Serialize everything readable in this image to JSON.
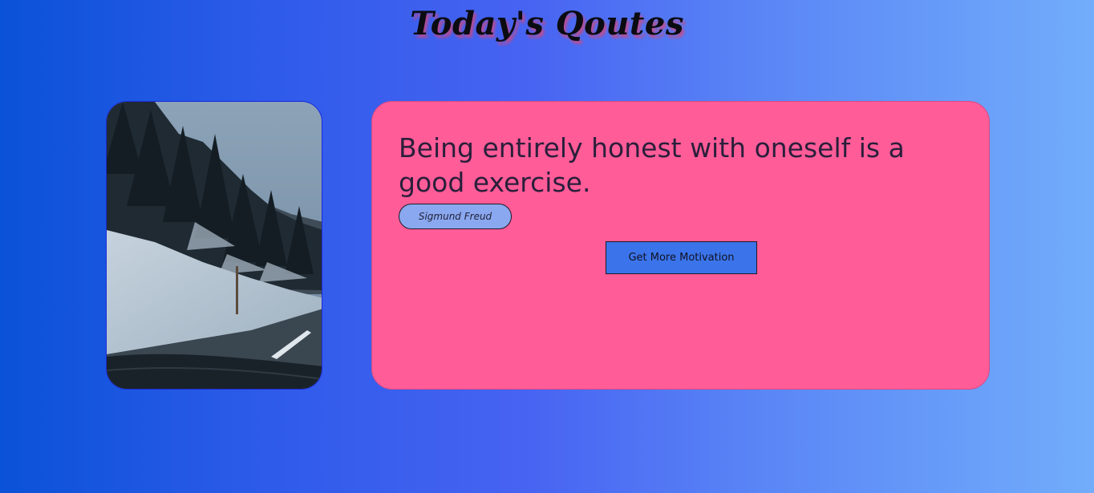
{
  "header": {
    "title": "Today's Qoutes"
  },
  "quote": {
    "text": "Being entirely honest with oneself is a good exercise.",
    "author": "Sigmund Freud"
  },
  "actions": {
    "more_label": "Get More Motivation"
  },
  "colors": {
    "card": "#ff5c98",
    "button": "#3b74ea",
    "author_pill": "#8aa8ef",
    "gradient_start": "#0a52d8",
    "gradient_end": "#72adfb"
  },
  "image": {
    "icon": "snowy-forest-road-photo"
  }
}
